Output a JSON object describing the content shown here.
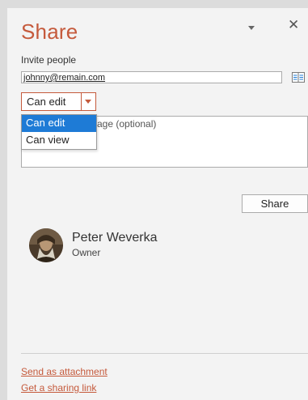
{
  "pane": {
    "title": "Share",
    "menu_icon": "chevron-down-icon",
    "close_icon": "close-icon",
    "close_glyph": "✕"
  },
  "invite": {
    "label": "Invite people",
    "value": "johnny@remain.com",
    "address_book_icon": "address-book-icon"
  },
  "permission": {
    "selected": "Can edit",
    "options": [
      "Can edit",
      "Can view"
    ],
    "highlighted_index": 0
  },
  "message": {
    "placeholder_visible": "age (optional)"
  },
  "share_button": {
    "label": "Share"
  },
  "users": [
    {
      "name": "Peter Weverka",
      "role": "Owner"
    }
  ],
  "links": {
    "send_attachment": "Send as attachment",
    "sharing_link": "Get a sharing link"
  },
  "colors": {
    "accent": "#c55a3c",
    "selection": "#1e7bd6",
    "pane_bg": "#f3f3f3",
    "outer_bg": "#dcdcdc"
  }
}
